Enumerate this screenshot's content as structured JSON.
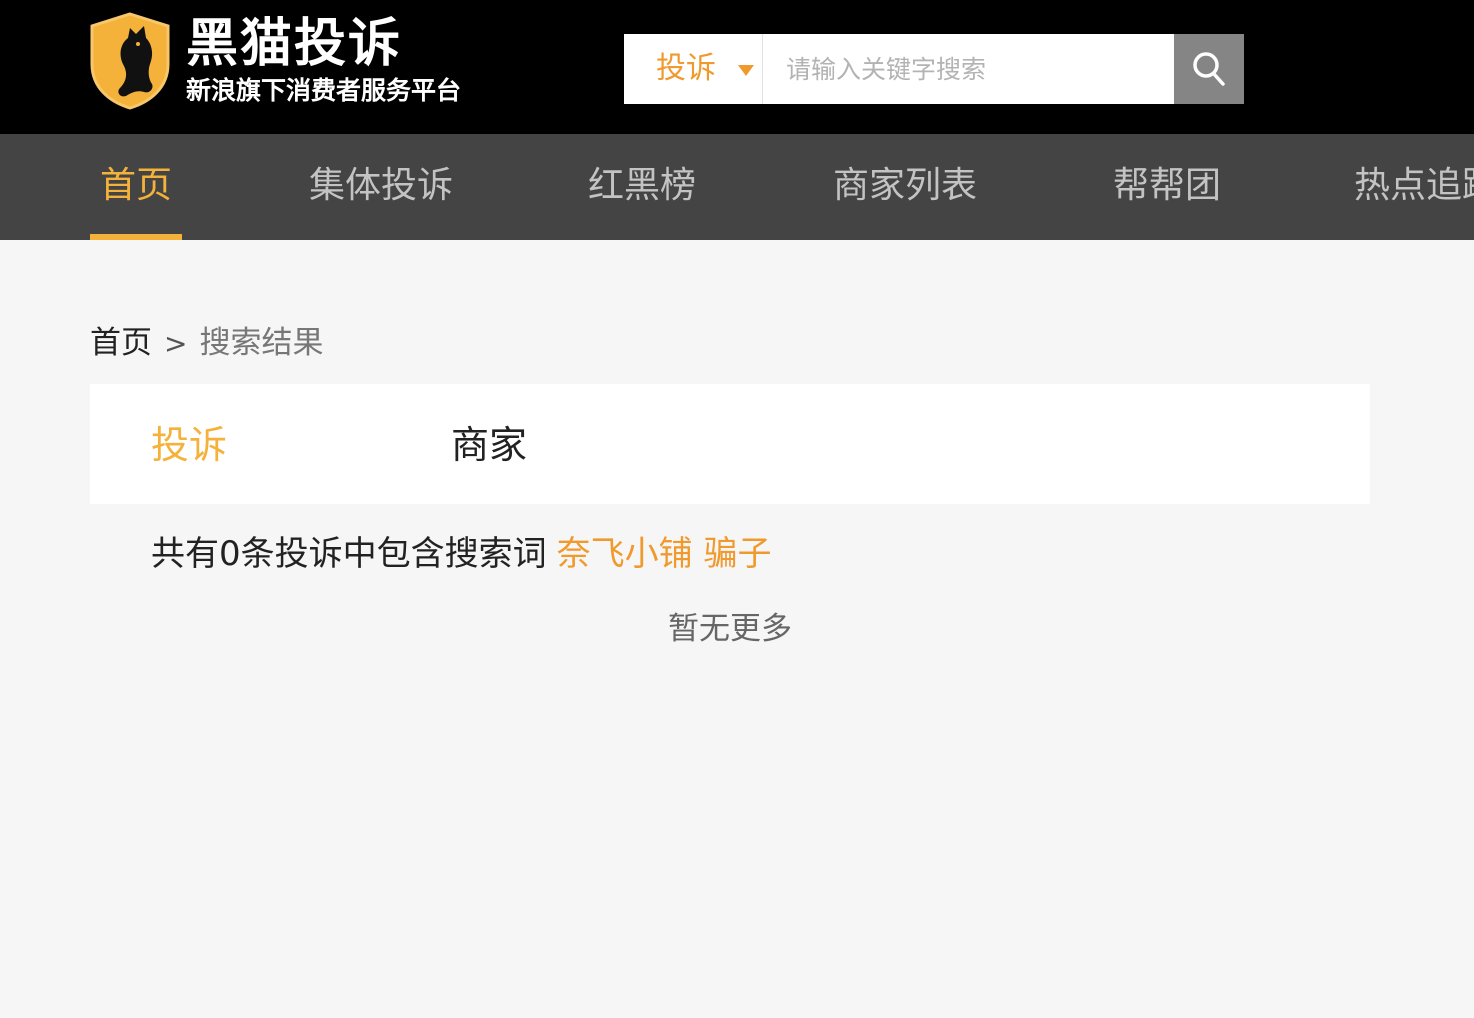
{
  "header": {
    "logo_title": "黑猫投诉",
    "logo_subtitle": "新浪旗下消费者服务平台",
    "logo_icon": "cat-shield-icon",
    "search": {
      "type_label": "投诉",
      "placeholder": "请输入关键字搜索",
      "value": "",
      "button_icon": "search-icon"
    }
  },
  "nav": {
    "items": [
      {
        "label": "首页",
        "active": true
      },
      {
        "label": "集体投诉",
        "active": false
      },
      {
        "label": "红黑榜",
        "active": false
      },
      {
        "label": "商家列表",
        "active": false
      },
      {
        "label": "帮帮团",
        "active": false
      },
      {
        "label": "热点追踪",
        "active": false
      }
    ]
  },
  "breadcrumb": {
    "home": "首页",
    "separator": ">",
    "current": "搜索结果"
  },
  "tabs": {
    "complaints": "投诉",
    "merchants": "商家",
    "active": "complaints"
  },
  "results": {
    "summary_prefix": "共有0条投诉中包含搜索词",
    "keyword": "奈飞小铺 骗子",
    "no_more": "暂无更多"
  },
  "colors": {
    "topbar_bg": "#000000",
    "nav_bg": "#444444",
    "accent": "#f4b23a",
    "keyword": "#f09a2e",
    "page_bg": "#f6f6f6"
  }
}
